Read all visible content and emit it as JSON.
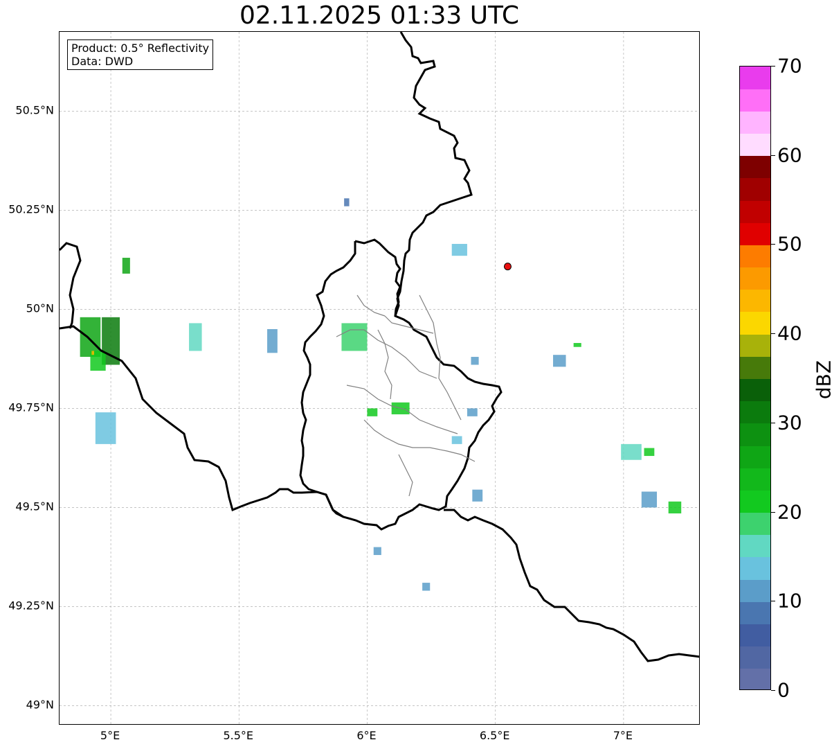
{
  "title": "02.11.2025 01:33 UTC",
  "info_box": {
    "product": "Product: 0.5° Reflectivity",
    "data": "Data: DWD"
  },
  "lat_labels": [
    "50.5°N",
    "50.25°N",
    "50°N",
    "49.75°N",
    "49.5°N",
    "49.25°N",
    "49°N"
  ],
  "lon_labels": [
    "5°E",
    "5.5°E",
    "6°E",
    "6.5°E",
    "7°E"
  ],
  "colorbar": {
    "label": "dBZ",
    "ticks": [
      "0",
      "10",
      "20",
      "30",
      "40",
      "50",
      "60",
      "70"
    ],
    "colors": [
      "#6370a8",
      "#5167a3",
      "#415da1",
      "#4a76b0",
      "#5b9dc9",
      "#69c2de",
      "#61d8c2",
      "#3dd26e",
      "#12c91f",
      "#12b81b",
      "#0fa615",
      "#0d9111",
      "#0b7b0d",
      "#0a6009",
      "#477a0a",
      "#a8b20a",
      "#fbd700",
      "#fcb700",
      "#fc9a00",
      "#fd7c00",
      "#e00000",
      "#c10000",
      "#a00000",
      "#7e0000",
      "#ffdcff",
      "#ffb4ff",
      "#ff6ff7",
      "#e93ced"
    ]
  },
  "radar_site": {
    "lon": 6.548,
    "lat": 50.108,
    "color": "#e81010"
  },
  "chart_data": {
    "type": "map",
    "projection": "lat-lon",
    "xlim": [
      4.8,
      7.3
    ],
    "ylim": [
      48.95,
      50.7
    ],
    "grid": true,
    "lon_ticks": [
      5.0,
      5.5,
      6.0,
      6.5,
      7.0
    ],
    "lat_ticks": [
      49.0,
      49.25,
      49.5,
      49.75,
      50.0,
      50.25,
      50.5
    ],
    "echoes": [
      {
        "lon": 4.92,
        "lat": 49.93,
        "dlon": 0.08,
        "dlat": 0.1,
        "dbz": 26
      },
      {
        "lon": 5.0,
        "lat": 49.92,
        "dlon": 0.07,
        "dlat": 0.12,
        "dbz": 30
      },
      {
        "lon": 4.95,
        "lat": 49.87,
        "dlon": 0.06,
        "dlat": 0.05,
        "dbz": 22
      },
      {
        "lon": 4.93,
        "lat": 49.89,
        "dlon": 0.01,
        "dlat": 0.01,
        "dbz": 44
      },
      {
        "lon": 5.06,
        "lat": 50.11,
        "dlon": 0.03,
        "dlat": 0.04,
        "dbz": 26
      },
      {
        "lon": 4.98,
        "lat": 49.7,
        "dlon": 0.08,
        "dlat": 0.08,
        "dbz": 14
      },
      {
        "lon": 5.33,
        "lat": 49.93,
        "dlon": 0.05,
        "dlat": 0.07,
        "dbz": 16
      },
      {
        "lon": 5.63,
        "lat": 49.92,
        "dlon": 0.04,
        "dlat": 0.06,
        "dbz": 12
      },
      {
        "lon": 5.95,
        "lat": 49.93,
        "dlon": 0.1,
        "dlat": 0.07,
        "dbz": 18
      },
      {
        "lon": 6.13,
        "lat": 49.75,
        "dlon": 0.07,
        "dlat": 0.03,
        "dbz": 22
      },
      {
        "lon": 6.02,
        "lat": 49.74,
        "dlon": 0.04,
        "dlat": 0.02,
        "dbz": 20
      },
      {
        "lon": 6.41,
        "lat": 49.74,
        "dlon": 0.04,
        "dlat": 0.02,
        "dbz": 12
      },
      {
        "lon": 6.35,
        "lat": 49.67,
        "dlon": 0.04,
        "dlat": 0.02,
        "dbz": 14
      },
      {
        "lon": 6.43,
        "lat": 49.53,
        "dlon": 0.04,
        "dlat": 0.03,
        "dbz": 10
      },
      {
        "lon": 6.36,
        "lat": 50.15,
        "dlon": 0.06,
        "dlat": 0.03,
        "dbz": 14
      },
      {
        "lon": 6.42,
        "lat": 49.87,
        "dlon": 0.03,
        "dlat": 0.02,
        "dbz": 12
      },
      {
        "lon": 6.75,
        "lat": 49.87,
        "dlon": 0.05,
        "dlat": 0.03,
        "dbz": 12
      },
      {
        "lon": 6.82,
        "lat": 49.91,
        "dlon": 0.03,
        "dlat": 0.01,
        "dbz": 20
      },
      {
        "lon": 7.03,
        "lat": 49.64,
        "dlon": 0.08,
        "dlat": 0.04,
        "dbz": 16
      },
      {
        "lon": 7.1,
        "lat": 49.64,
        "dlon": 0.04,
        "dlat": 0.02,
        "dbz": 22
      },
      {
        "lon": 7.2,
        "lat": 49.5,
        "dlon": 0.05,
        "dlat": 0.03,
        "dbz": 20
      },
      {
        "lon": 7.1,
        "lat": 49.52,
        "dlon": 0.06,
        "dlat": 0.04,
        "dbz": 12
      },
      {
        "lon": 6.23,
        "lat": 49.3,
        "dlon": 0.03,
        "dlat": 0.02,
        "dbz": 10
      },
      {
        "lon": 6.04,
        "lat": 49.39,
        "dlon": 0.03,
        "dlat": 0.02,
        "dbz": 10
      },
      {
        "lon": 5.92,
        "lat": 50.27,
        "dlon": 0.02,
        "dlat": 0.02,
        "dbz": 8
      }
    ]
  }
}
